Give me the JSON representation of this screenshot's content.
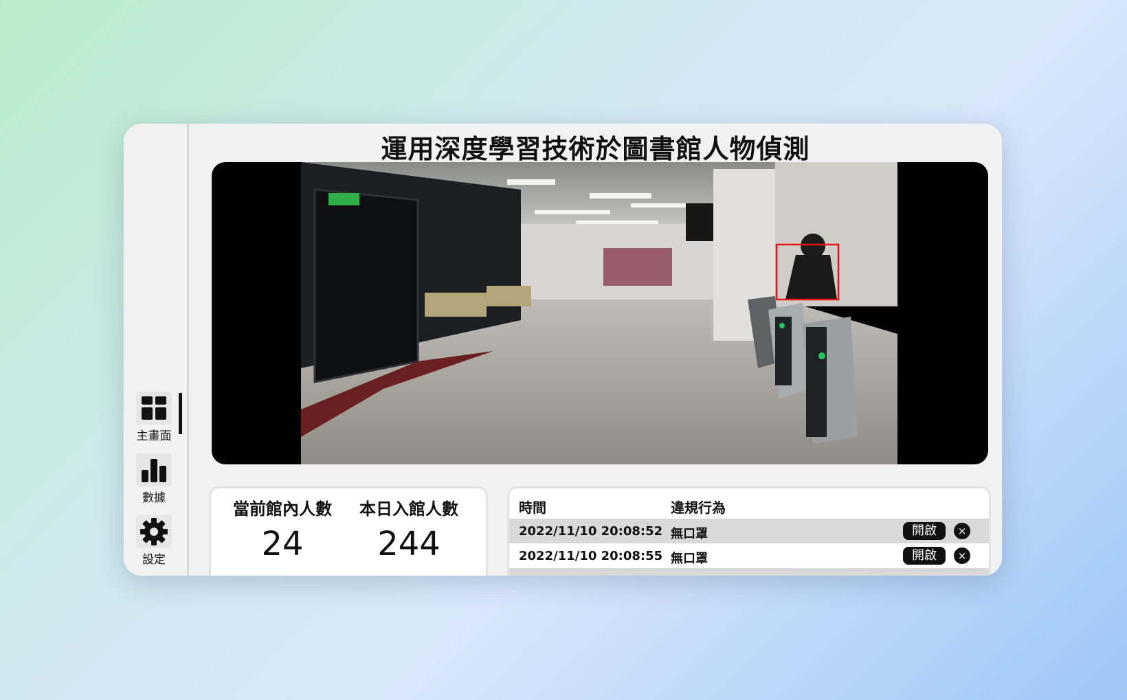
{
  "app": {
    "title": "運用深度學習技術於圖書館人物偵測"
  },
  "sidebar": {
    "items": [
      {
        "label": "主畫面",
        "icon": "dashboard-icon",
        "active": true
      },
      {
        "label": "數據",
        "icon": "bar-chart-icon",
        "active": false
      },
      {
        "label": "設定",
        "icon": "gear-icon",
        "active": false
      }
    ]
  },
  "video": {
    "detection_box_color": "#e8141c",
    "gate_light_color": "#22c55e"
  },
  "stats": {
    "current_label": "當前館內人數",
    "current_value": "24",
    "today_label": "本日入館人數",
    "today_value": "244"
  },
  "log": {
    "columns": [
      "時間",
      "違規行為"
    ],
    "rows": [
      {
        "time": "2022/11/10 20:08:52",
        "violation": "無口罩",
        "open_label": "開啟",
        "close_label": "×"
      },
      {
        "time": "2022/11/10 20:08:55",
        "violation": "無口罩",
        "open_label": "開啟",
        "close_label": "×"
      }
    ]
  }
}
